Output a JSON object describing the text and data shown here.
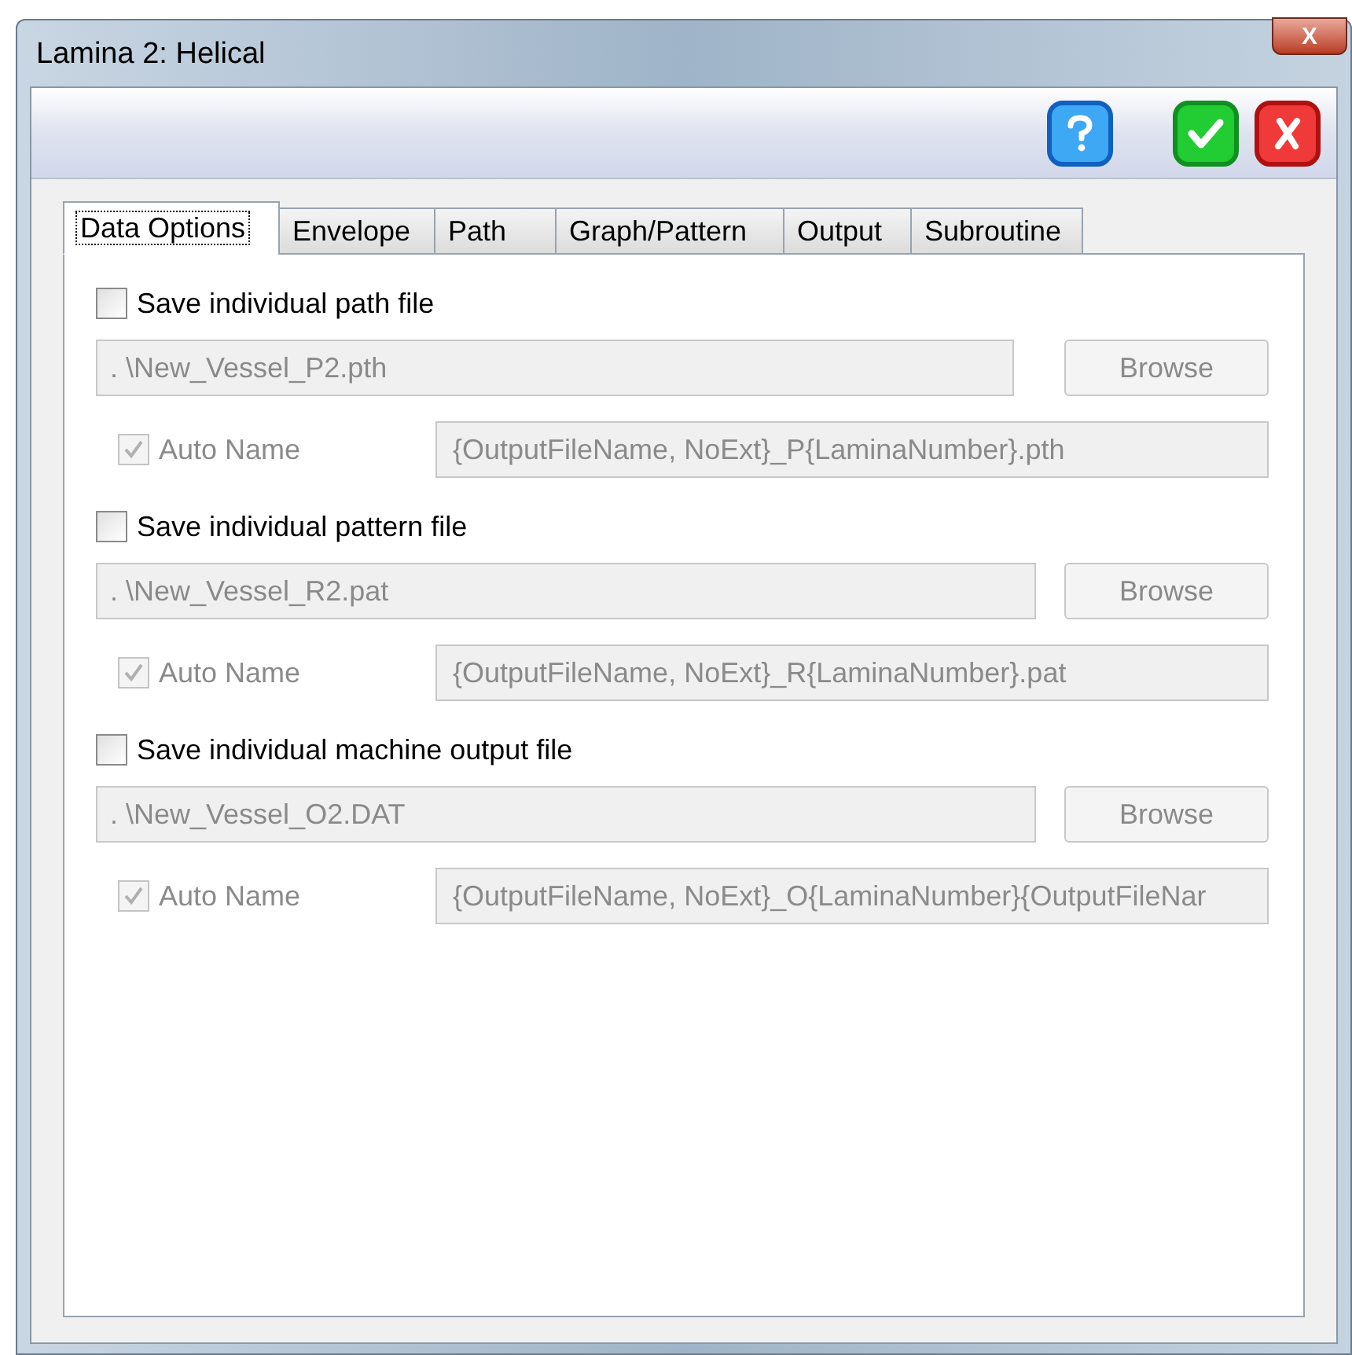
{
  "window": {
    "title": "Lamina 2: Helical",
    "close": "X"
  },
  "toolbar": [
    {
      "kind": "help"
    },
    {
      "kind": "ok"
    },
    {
      "kind": "cancel"
    }
  ],
  "tabs": [
    {
      "label": "Data Options",
      "selected": true
    },
    {
      "label": "Envelope",
      "selected": false
    },
    {
      "label": "Path",
      "selected": false
    },
    {
      "label": "Graph/Pattern",
      "selected": false
    },
    {
      "label": "Output",
      "selected": false
    },
    {
      "label": "Subroutine",
      "selected": false
    }
  ],
  "sections": [
    {
      "label": "Save individual path file",
      "checked": false,
      "disabled": true,
      "path": ". \\New_Vessel_P2.pth",
      "browse": "Browse",
      "auto_name": {
        "label": "Auto Name",
        "checked": true
      },
      "pattern": "{OutputFileName, NoExt}_P{LaminaNumber}.pth"
    },
    {
      "label": "Save individual pattern file",
      "checked": false,
      "disabled": true,
      "path": ". \\New_Vessel_R2.pat",
      "browse": "Browse",
      "auto_name": {
        "label": "Auto Name",
        "checked": true
      },
      "pattern": "{OutputFileName, NoExt}_R{LaminaNumber}.pat"
    },
    {
      "label": "Save individual machine output file",
      "checked": false,
      "disabled": true,
      "path": ". \\New_Vessel_O2.DAT",
      "browse": "Browse",
      "auto_name": {
        "label": "Auto Name",
        "checked": true
      },
      "pattern": "{OutputFileName, NoExt}_O{LaminaNumber}{OutputFileNar"
    }
  ]
}
